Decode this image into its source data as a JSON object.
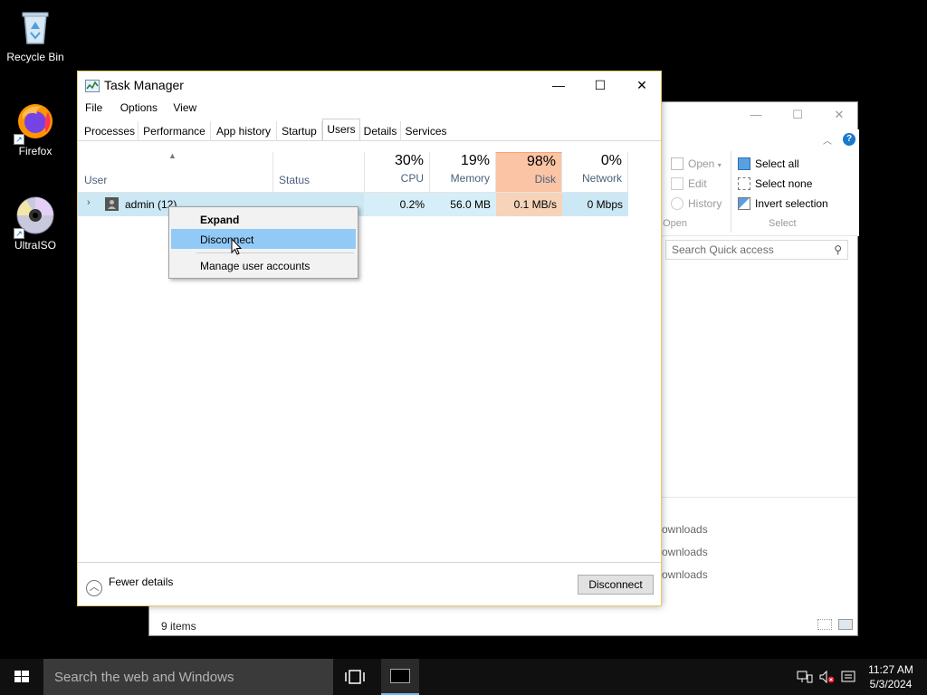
{
  "desktop": {
    "icons": [
      {
        "label": "Recycle Bin"
      },
      {
        "label": "Firefox"
      },
      {
        "label": "UltraISO"
      }
    ]
  },
  "explorer": {
    "ribbon": {
      "open": "Open",
      "edit": "Edit",
      "history": "History",
      "open_group": "Open",
      "select_all": "Select all",
      "select_none": "Select none",
      "invert_selection": "Invert selection",
      "select_group": "Select"
    },
    "search_placeholder": "Search Quick access",
    "downloads": [
      "ownloads",
      "ownloads",
      "ownloads"
    ],
    "status": "9 items"
  },
  "task_manager": {
    "title": "Task Manager",
    "menu": [
      "File",
      "Options",
      "View"
    ],
    "tabs": [
      "Processes",
      "Performance",
      "App history",
      "Startup",
      "Users",
      "Details",
      "Services"
    ],
    "active_tab": "Users",
    "columns": {
      "user": "User",
      "status": "Status",
      "cpu": {
        "pct": "30%",
        "name": "CPU"
      },
      "memory": {
        "pct": "19%",
        "name": "Memory"
      },
      "disk": {
        "pct": "98%",
        "name": "Disk"
      },
      "network": {
        "pct": "0%",
        "name": "Network"
      }
    },
    "rows": [
      {
        "user": "admin (12)",
        "status": "",
        "cpu": "0.2%",
        "memory": "56.0 MB",
        "disk": "0.1 MB/s",
        "network": "0 Mbps"
      }
    ],
    "fewer_details": "Fewer details",
    "disconnect_button": "Disconnect",
    "context_menu": {
      "items": [
        "Expand",
        "Disconnect",
        "Manage user accounts"
      ],
      "highlighted": "Disconnect"
    }
  },
  "taskbar": {
    "search_placeholder": "Search the web and Windows",
    "time": "11:27 AM",
    "date": "5/3/2024"
  },
  "colors": {
    "disk_header": "#fbc4a5",
    "row_highlight": "#cce8f4",
    "menu_highlight": "#91c9f7",
    "taskbar": "#101010"
  }
}
